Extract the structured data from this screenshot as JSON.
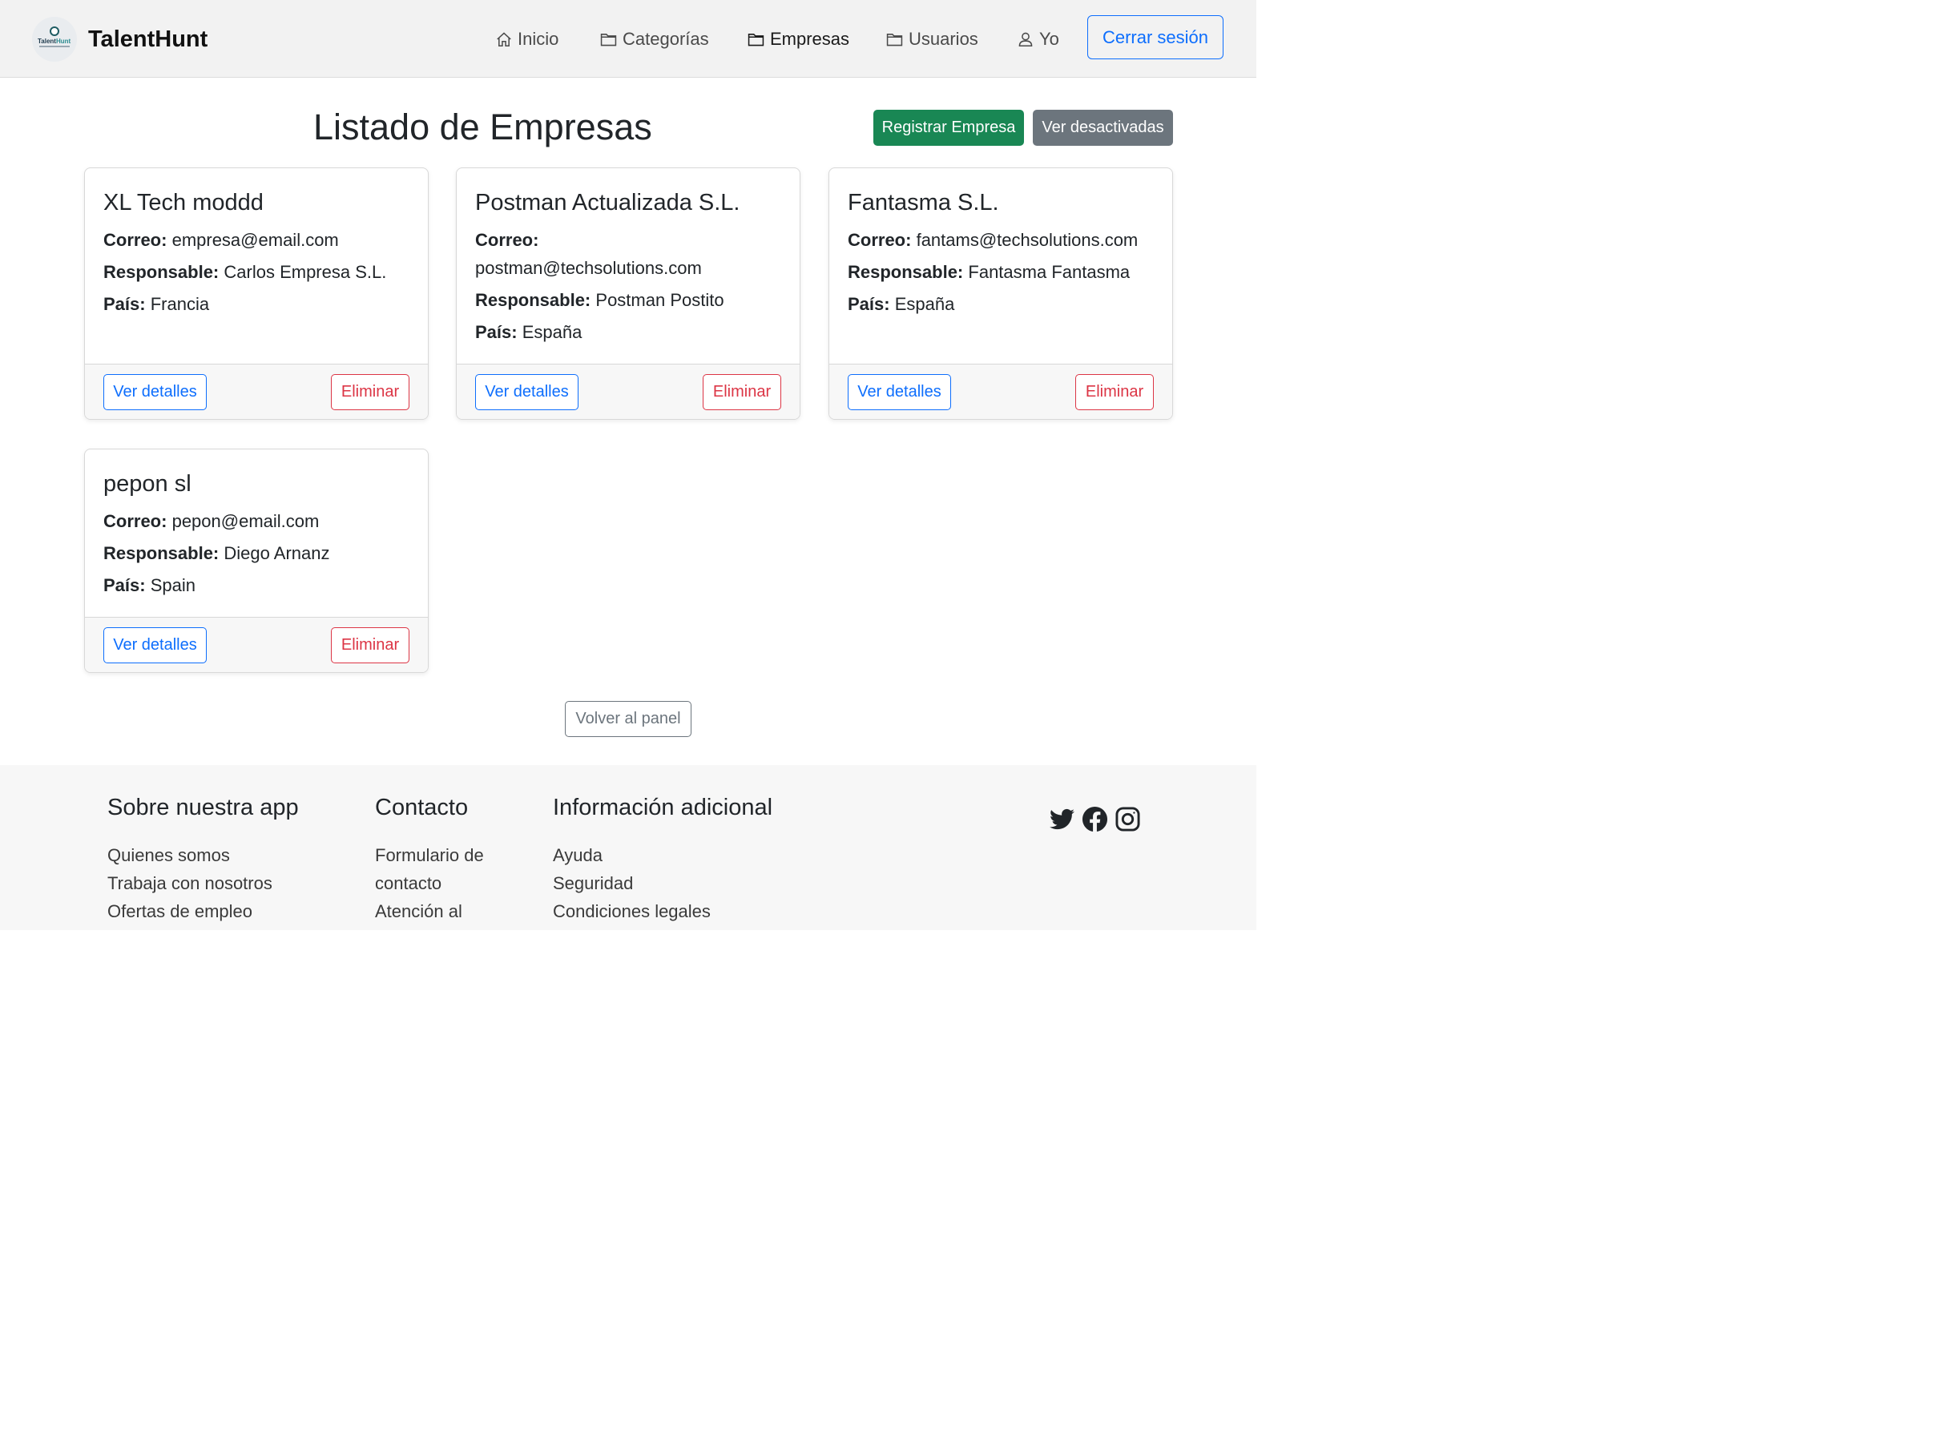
{
  "navbar": {
    "brand": "TalentHunt",
    "logo_text_a": "Talent",
    "logo_text_b": "Hunt",
    "items": [
      {
        "label": "Inicio",
        "icon": "house-icon"
      },
      {
        "label": "Categorías",
        "icon": "folder-icon"
      },
      {
        "label": "Empresas",
        "icon": "folder-icon"
      },
      {
        "label": "Usuarios",
        "icon": "folder-icon"
      },
      {
        "label": "Yo",
        "icon": "person-icon"
      }
    ],
    "logout_label": "Cerrar sesión"
  },
  "page": {
    "title": "Listado de Empresas",
    "register_label": "Registrar Empresa",
    "deactivated_label": "Ver desactivadas",
    "back_label": "Volver al panel"
  },
  "labels": {
    "email": "Correo:",
    "manager": "Responsable:",
    "country": "País:",
    "details": "Ver detalles",
    "delete": "Eliminar"
  },
  "companies": [
    {
      "name": "XL Tech moddd",
      "email": "empresa@email.com",
      "manager": "Carlos Empresa S.L.",
      "country": "Francia"
    },
    {
      "name": "Postman Actualizada S.L.",
      "email": "postman@techsolutions.com",
      "manager": "Postman Postito",
      "country": "España"
    },
    {
      "name": "Fantasma S.L.",
      "email": "fantams@techsolutions.com",
      "manager": "Fantasma Fantasma",
      "country": "España"
    },
    {
      "name": "pepon sl",
      "email": "pepon@email.com",
      "manager": "Diego Arnanz",
      "country": "Spain"
    }
  ],
  "footer": {
    "columns": [
      {
        "title": "Sobre nuestra app",
        "links": [
          "Quienes somos",
          "Trabaja con nosotros",
          "Ofertas de empleo"
        ]
      },
      {
        "title": "Contacto",
        "links": [
          "Formulario de contacto",
          "Atención al"
        ]
      },
      {
        "title": "Información adicional",
        "links": [
          "Ayuda",
          "Seguridad",
          "Condiciones legales"
        ]
      }
    ],
    "social": [
      "twitter-icon",
      "facebook-icon",
      "instagram-icon"
    ]
  },
  "colors": {
    "primary": "#0d6efd",
    "success": "#198754",
    "secondary": "#6c757d",
    "danger": "#dc3545"
  }
}
